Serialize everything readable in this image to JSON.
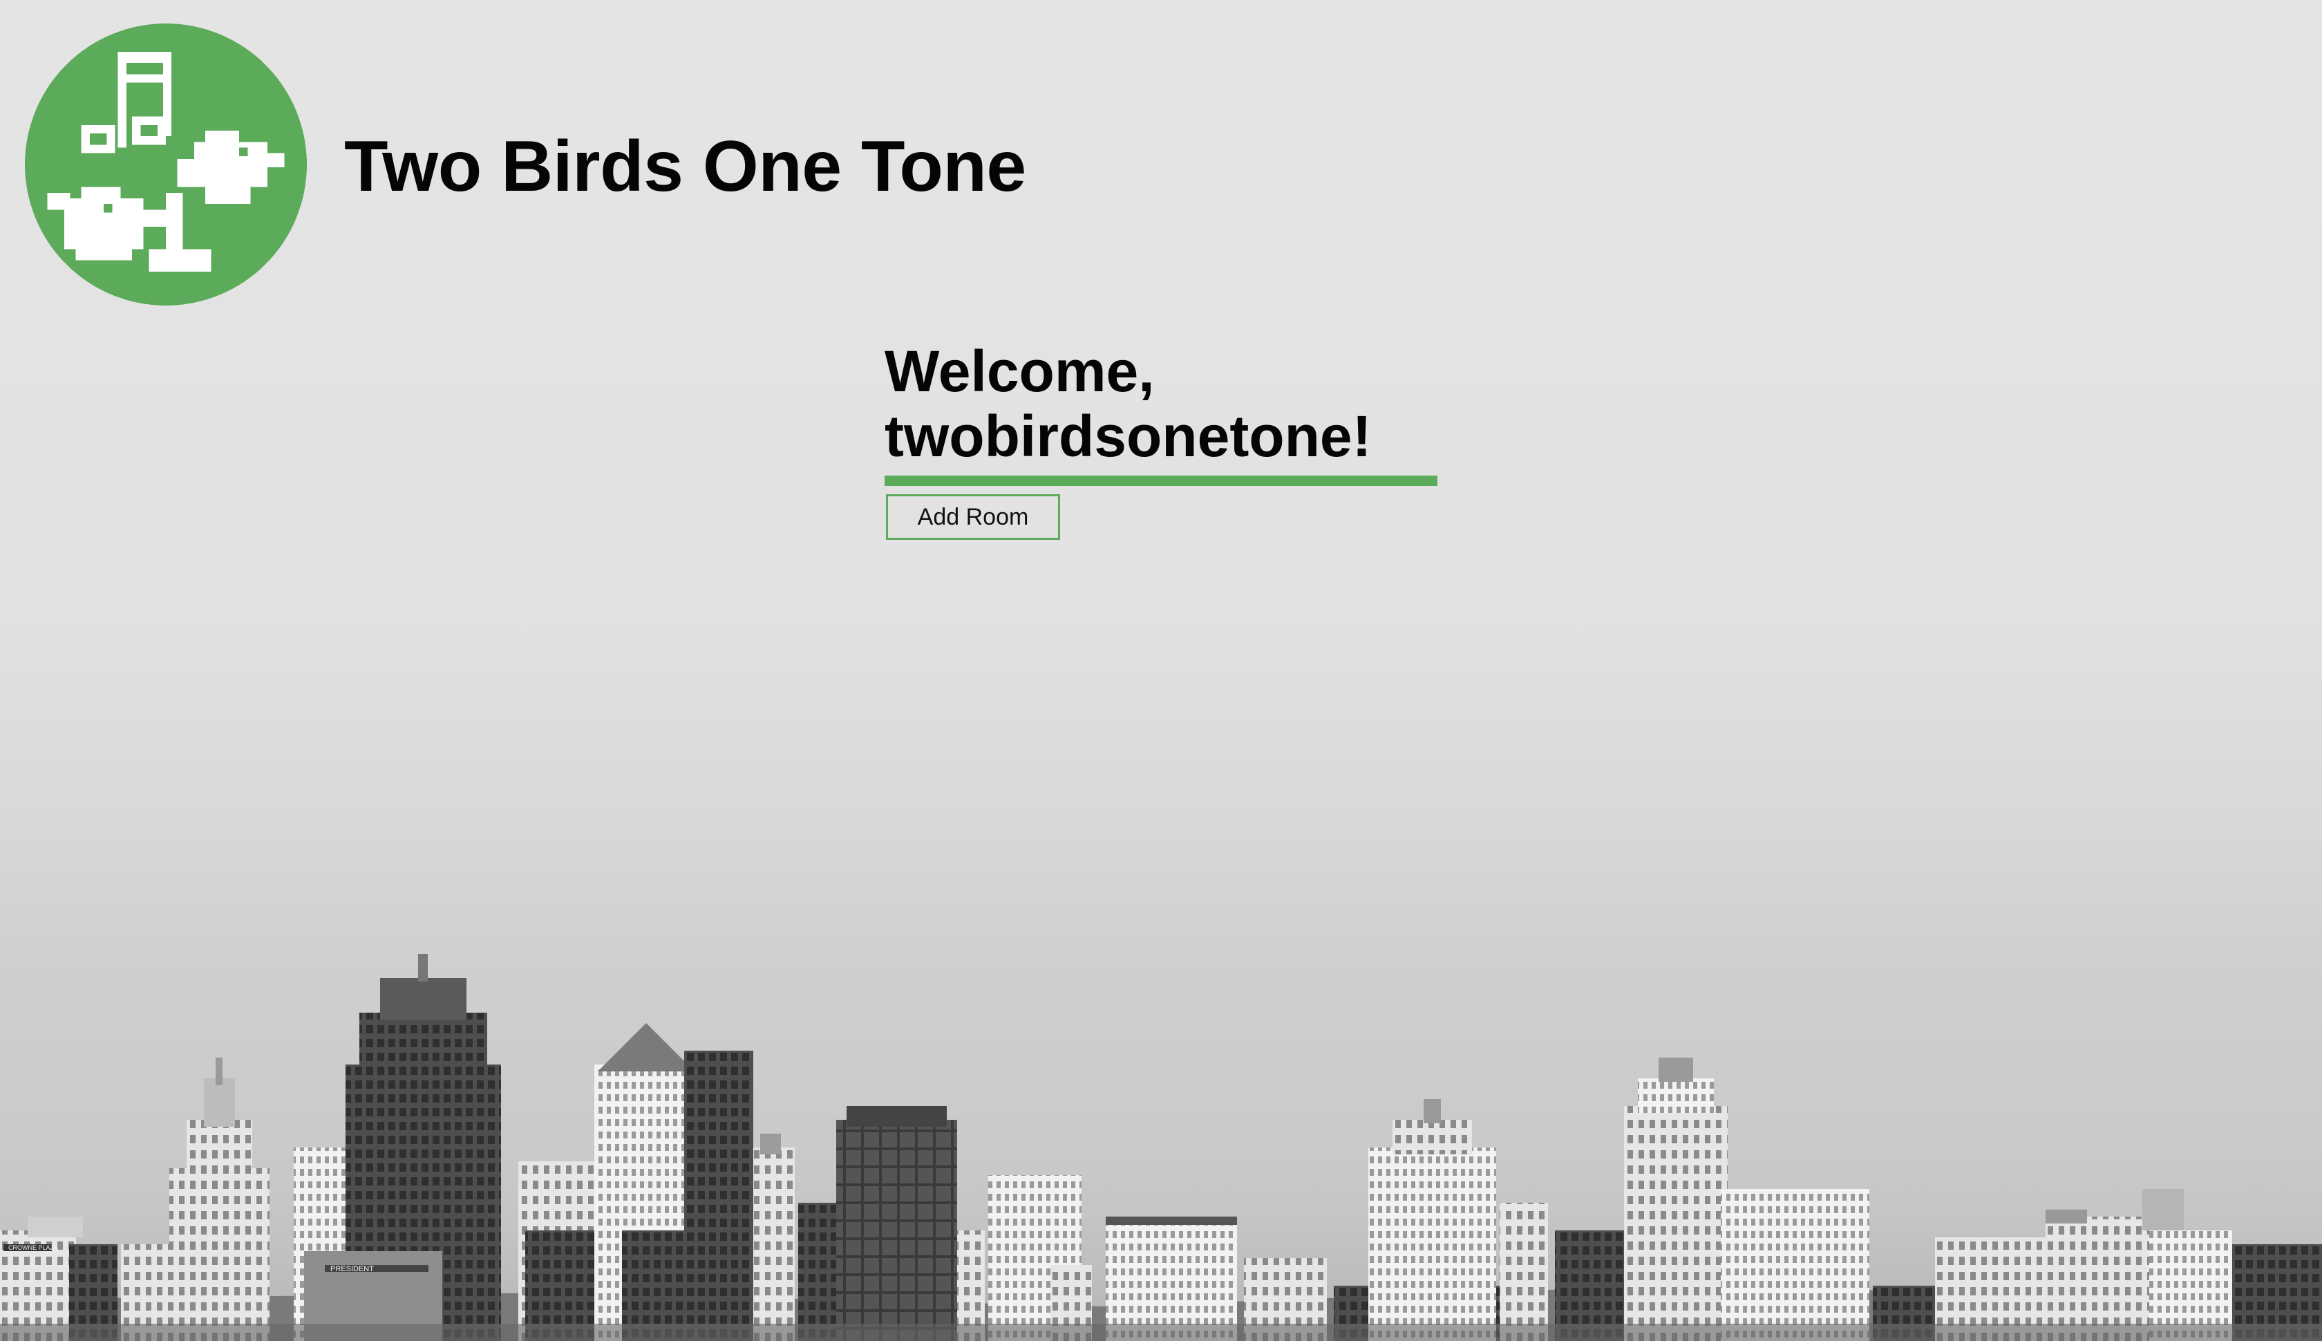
{
  "header": {
    "title": "Two Birds One Tone",
    "logo_icon": "pixel-birds-music-note-icon",
    "logo_color": "#5cab5a"
  },
  "main": {
    "welcome_line1": "Welcome,",
    "welcome_line2": "twobirdsonetone!",
    "add_room_label": "Add Room",
    "accent_color": "#5cab5a"
  },
  "background": {
    "image": "grayscale-city-skyline",
    "signs": [
      "CROWNE PLAZA",
      "PRESIDENT"
    ]
  }
}
